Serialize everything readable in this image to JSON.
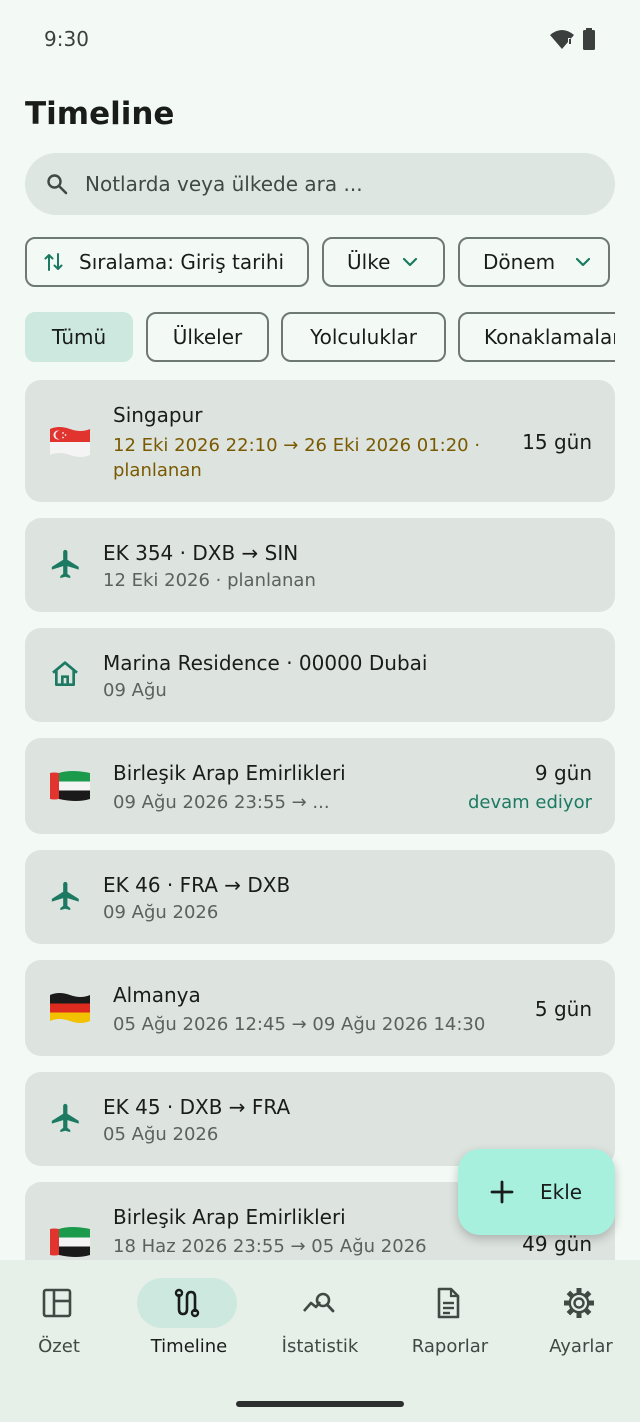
{
  "status": {
    "time": "9:30"
  },
  "header": {
    "title": "Timeline"
  },
  "search": {
    "placeholder": "Notlarda veya ülkede ara ..."
  },
  "sort_chips": {
    "sort": "Sıralama: Giriş tarihi",
    "country": "Ülke",
    "period": "Dönem"
  },
  "filter_tabs": [
    "Tümü",
    "Ülkeler",
    "Yolculuklar",
    "Konaklamalar"
  ],
  "entries": [
    {
      "kind": "country",
      "flag": "singapore-flag",
      "title": "Singapur",
      "sub1": "12 Eki 2026 22:10  →  26 Eki 2026 01:20 ·",
      "sub2": "planlanan",
      "days": "15 gün"
    },
    {
      "kind": "flight",
      "title": "EK 354 · DXB → SIN",
      "sub1": "12 Eki 2026 · planlanan"
    },
    {
      "kind": "stay",
      "title": "Marina Residence · 00000 Dubai",
      "sub1": "09 Ağu"
    },
    {
      "kind": "country",
      "flag": "uae-flag",
      "title": "Birleşik Arap Emirlikleri",
      "sub1": "09 Ağu 2026 23:55  →  ...",
      "days": "9 gün",
      "status": "devam ediyor"
    },
    {
      "kind": "flight",
      "title": "EK 46 · FRA → DXB",
      "sub1": "09 Ağu 2026"
    },
    {
      "kind": "country",
      "flag": "germany-flag",
      "title": "Almanya",
      "sub1": "05 Ağu 2026 12:45  →  09 Ağu 2026 14:30",
      "days": "5 gün"
    },
    {
      "kind": "flight",
      "title": "EK 45 · DXB → FRA",
      "sub1": "05 Ağu 2026"
    },
    {
      "kind": "country",
      "flag": "uae-flag",
      "title": "Birleşik Arap Emirlikleri",
      "sub1": "18 Haz 2026 23:55  →  05 Ağu 2026",
      "days": "49 gün"
    }
  ],
  "fab": {
    "label": "Ekle"
  },
  "nav": [
    {
      "label": "Özet",
      "icon": "dashboard-icon"
    },
    {
      "label": "Timeline",
      "icon": "timeline-icon",
      "active": true
    },
    {
      "label": "İstatistik",
      "icon": "statistics-icon"
    },
    {
      "label": "Raporlar",
      "icon": "reports-icon"
    },
    {
      "label": "Ayarlar",
      "icon": "settings-icon"
    }
  ],
  "colors": {
    "accent": "#1c7a62",
    "planned": "#7a5a00",
    "fab": "#a7f0dd",
    "selected_chip": "#cde8df"
  }
}
